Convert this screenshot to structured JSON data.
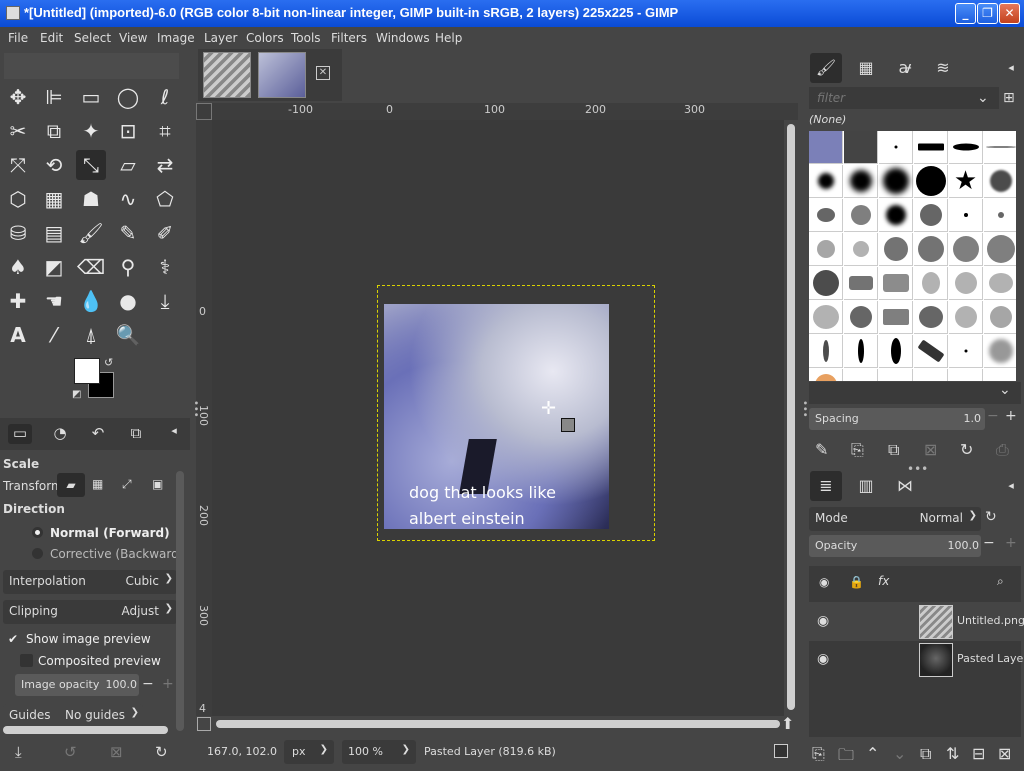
{
  "window": {
    "title": "*[Untitled] (imported)-6.0 (RGB color 8-bit non-linear integer, GIMP built-in sRGB, 2 layers) 225x225 - GIMP"
  },
  "menu": [
    "File",
    "Edit",
    "Select",
    "View",
    "Image",
    "Layer",
    "Colors",
    "Tools",
    "Filters",
    "Windows",
    "Help"
  ],
  "toolbox": {
    "tool_options_title": "Scale",
    "transform_label": "Transform:",
    "direction_label": "Direction",
    "direction_options": [
      "Normal (Forward)",
      "Corrective (Backward)"
    ],
    "interpolation": {
      "label": "Interpolation",
      "value": "Cubic"
    },
    "clipping": {
      "label": "Clipping",
      "value": "Adjust"
    },
    "show_preview": "Show image preview",
    "composited_preview": "Composited preview",
    "image_opacity": {
      "label": "Image opacity",
      "value": "100.0"
    },
    "guides": {
      "label": "Guides",
      "value": "No guides"
    }
  },
  "canvas": {
    "ruler_top": [
      "-100",
      "0",
      "100",
      "200",
      "300"
    ],
    "ruler_left": [
      "0",
      "100",
      "200",
      "300",
      "4"
    ],
    "image_caption": "dog that looks like\nalbert einstein"
  },
  "statusbar": {
    "coords": "167.0, 102.0",
    "unit": "px",
    "zoom": "100 %",
    "message": "Pasted Layer (819.6 kB)"
  },
  "brushes": {
    "filter_placeholder": "filter",
    "current": "(None)",
    "spacing": {
      "label": "Spacing",
      "value": "1.0"
    }
  },
  "layers": {
    "mode": {
      "label": "Mode",
      "value": "Normal"
    },
    "opacity": {
      "label": "Opacity",
      "value": "100.0"
    },
    "items": [
      {
        "name": "Untitled.png"
      },
      {
        "name": "Pasted Layer"
      }
    ]
  },
  "icons": {
    "checkmark": "✔"
  }
}
